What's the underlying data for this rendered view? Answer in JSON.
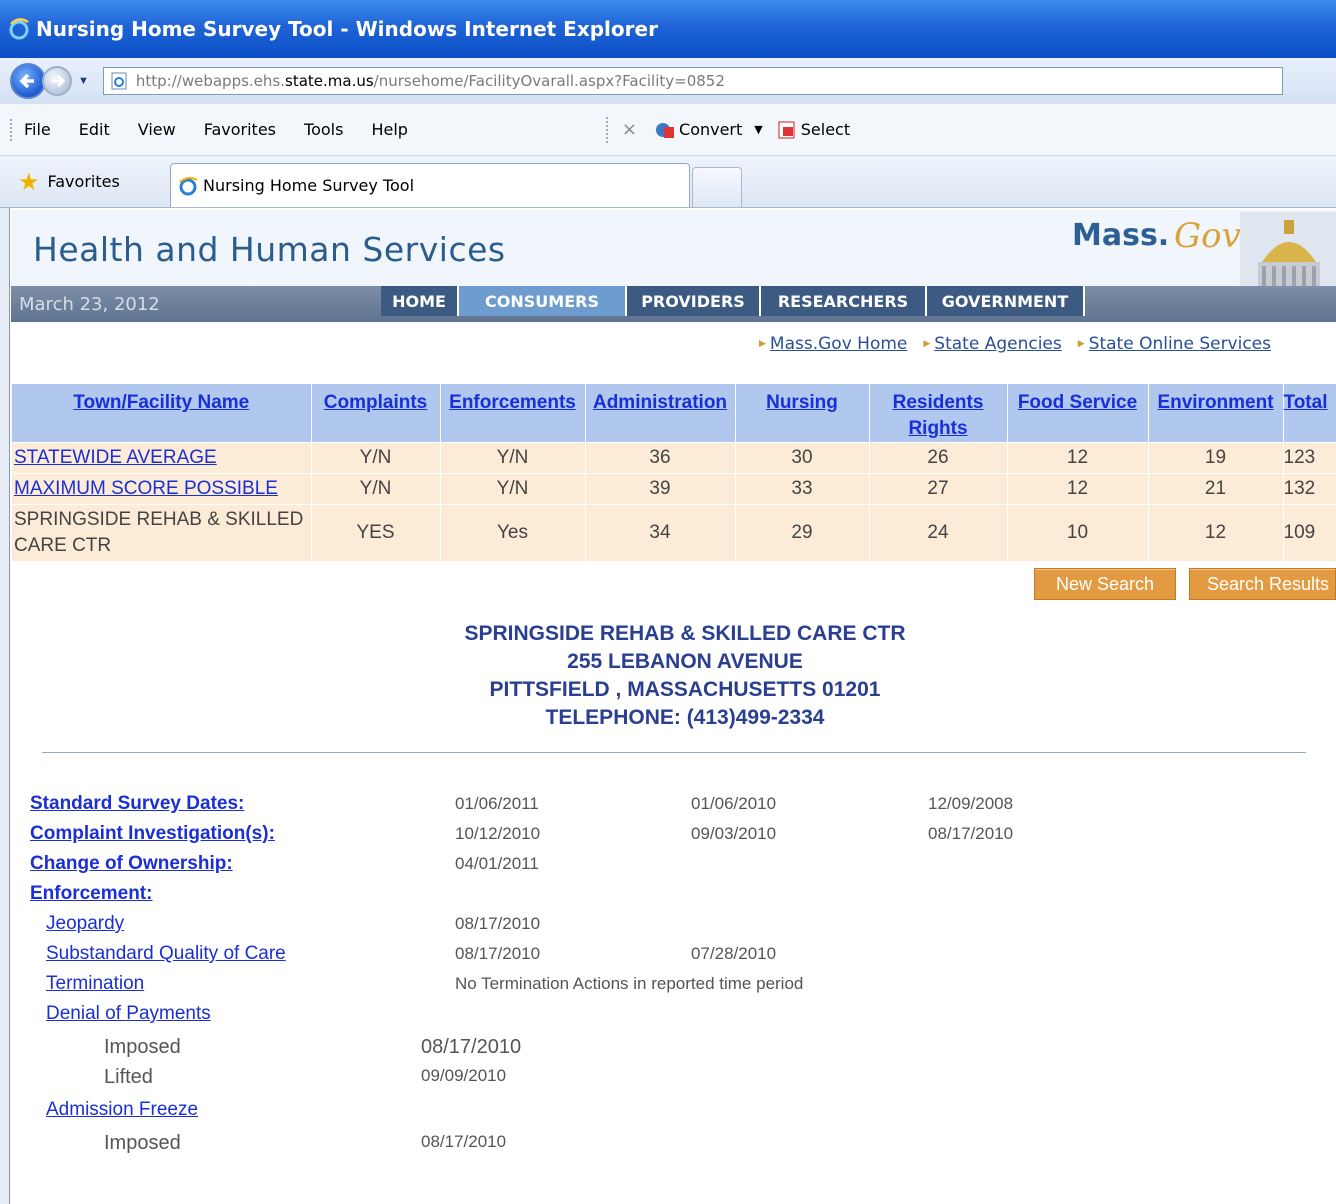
{
  "browser": {
    "window_title": "Nursing Home Survey Tool - Windows Internet Explorer",
    "url_prefix": "http://webapps.ehs.",
    "url_host": "state.ma.us",
    "url_suffix": "/nursehome/FacilityOvarall.aspx?Facility=0852",
    "menu": [
      "File",
      "Edit",
      "View",
      "Favorites",
      "Tools",
      "Help"
    ],
    "close_glyph": "×",
    "convert_label": "Convert",
    "select_label": "Select",
    "favorites_label": "Favorites",
    "tab_title": "Nursing Home Survey Tool"
  },
  "site": {
    "title": "Health and Human Services",
    "logo_mass": "Mass.",
    "logo_gov": "Gov",
    "date": "March 23, 2012",
    "nav": [
      "HOME",
      "CONSUMERS",
      "PROVIDERS",
      "RESEARCHERS",
      "GOVERNMENT"
    ],
    "active_nav": "CONSUMERS",
    "quicklinks": [
      "Mass.Gov Home",
      "State Agencies",
      "State Online Services"
    ]
  },
  "scores": {
    "headers": [
      "Town/Facility Name",
      "Complaints",
      "Enforcements",
      "Administration",
      "Nursing",
      "Residents Rights",
      "Food Service",
      "Environment",
      "Total"
    ],
    "rows": [
      {
        "name": "STATEWIDE AVERAGE",
        "complaints": "Y/N",
        "enforcements": "Y/N",
        "administration": "36",
        "nursing": "30",
        "residents_rights": "26",
        "food_service": "12",
        "environment": "19",
        "total": "123"
      },
      {
        "name": "MAXIMUM SCORE POSSIBLE",
        "complaints": "Y/N",
        "enforcements": "Y/N",
        "administration": "39",
        "nursing": "33",
        "residents_rights": "27",
        "food_service": "12",
        "environment": "21",
        "total": "132"
      },
      {
        "name": "SPRINGSIDE REHAB & SKILLED CARE CTR",
        "complaints": "YES",
        "enforcements": "Yes",
        "administration": "34",
        "nursing": "29",
        "residents_rights": "24",
        "food_service": "10",
        "environment": "12",
        "total": "109"
      }
    ]
  },
  "buttons": {
    "new_search": "New Search",
    "search_results": "Search Results"
  },
  "facility": {
    "name": "SPRINGSIDE REHAB & SKILLED CARE CTR",
    "address": "255 LEBANON AVENUE",
    "city": "PITTSFIELD , MASSACHUSETTS 01201",
    "phone": "TELEPHONE: (413)499-2334"
  },
  "details": {
    "standard_survey": {
      "label": "Standard Survey Dates:",
      "dates": [
        "01/06/2011",
        "01/06/2010",
        "12/09/2008"
      ]
    },
    "complaint": {
      "label": "Complaint Investigation(s):",
      "dates": [
        "10/12/2010",
        "09/03/2010",
        "08/17/2010"
      ]
    },
    "ownership": {
      "label": "Change of Ownership:",
      "dates": [
        "04/01/2011"
      ]
    },
    "enforcement_label": "Enforcement:",
    "jeopardy": {
      "label": "Jeopardy",
      "dates": [
        "08/17/2010"
      ]
    },
    "substandard": {
      "label": "Substandard Quality of Care",
      "dates": [
        "08/17/2010",
        "07/28/2010"
      ]
    },
    "termination": {
      "label": "Termination",
      "text": "No Termination Actions in reported time period"
    },
    "denial": {
      "label": "Denial of Payments",
      "imposed_label": "Imposed",
      "imposed": "08/17/2010",
      "lifted_label": "Lifted",
      "lifted": "09/09/2010"
    },
    "freeze": {
      "label": "Admission Freeze",
      "imposed_label": "Imposed",
      "imposed": "08/17/2010"
    }
  },
  "colors": {
    "header_bg": "#b0c7ee",
    "row_bg": "#fcebd7",
    "link": "#1a2fd6",
    "nav_dark": "#3c5a82",
    "nav_active": "#6e9ccf",
    "button_orange": "#e39b42"
  },
  "icons": [
    "ie-logo-icon",
    "back-arrow-icon",
    "forward-arrow-icon",
    "page-icon",
    "convert-pdf-icon",
    "select-pdf-icon",
    "favorites-star-icon",
    "capitol-dome-icon"
  ]
}
